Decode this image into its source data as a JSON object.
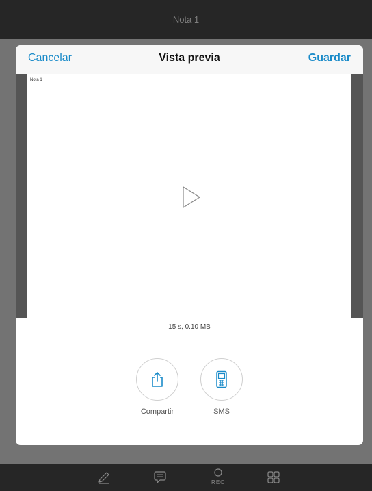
{
  "app": {
    "title": "Nota 1"
  },
  "modal": {
    "cancel_label": "Cancelar",
    "title": "Vista previa",
    "save_label": "Guardar"
  },
  "preview": {
    "note_title": "Nota 1",
    "meta": "15 s, 0.10 MB",
    "play_icon": "play-icon"
  },
  "share": {
    "items": [
      {
        "label": "Compartir",
        "icon": "share-icon"
      },
      {
        "label": "SMS",
        "icon": "phone-icon"
      }
    ]
  },
  "toolbar": {
    "items": [
      {
        "icon": "pencil-icon"
      },
      {
        "icon": "comment-icon"
      },
      {
        "icon": "record-icon",
        "label": "REC"
      },
      {
        "icon": "grid-icon"
      }
    ]
  },
  "colors": {
    "accent": "#1a8bc9",
    "top_bar": "#262626",
    "backdrop": "#737373",
    "preview_frame": "#555555"
  }
}
